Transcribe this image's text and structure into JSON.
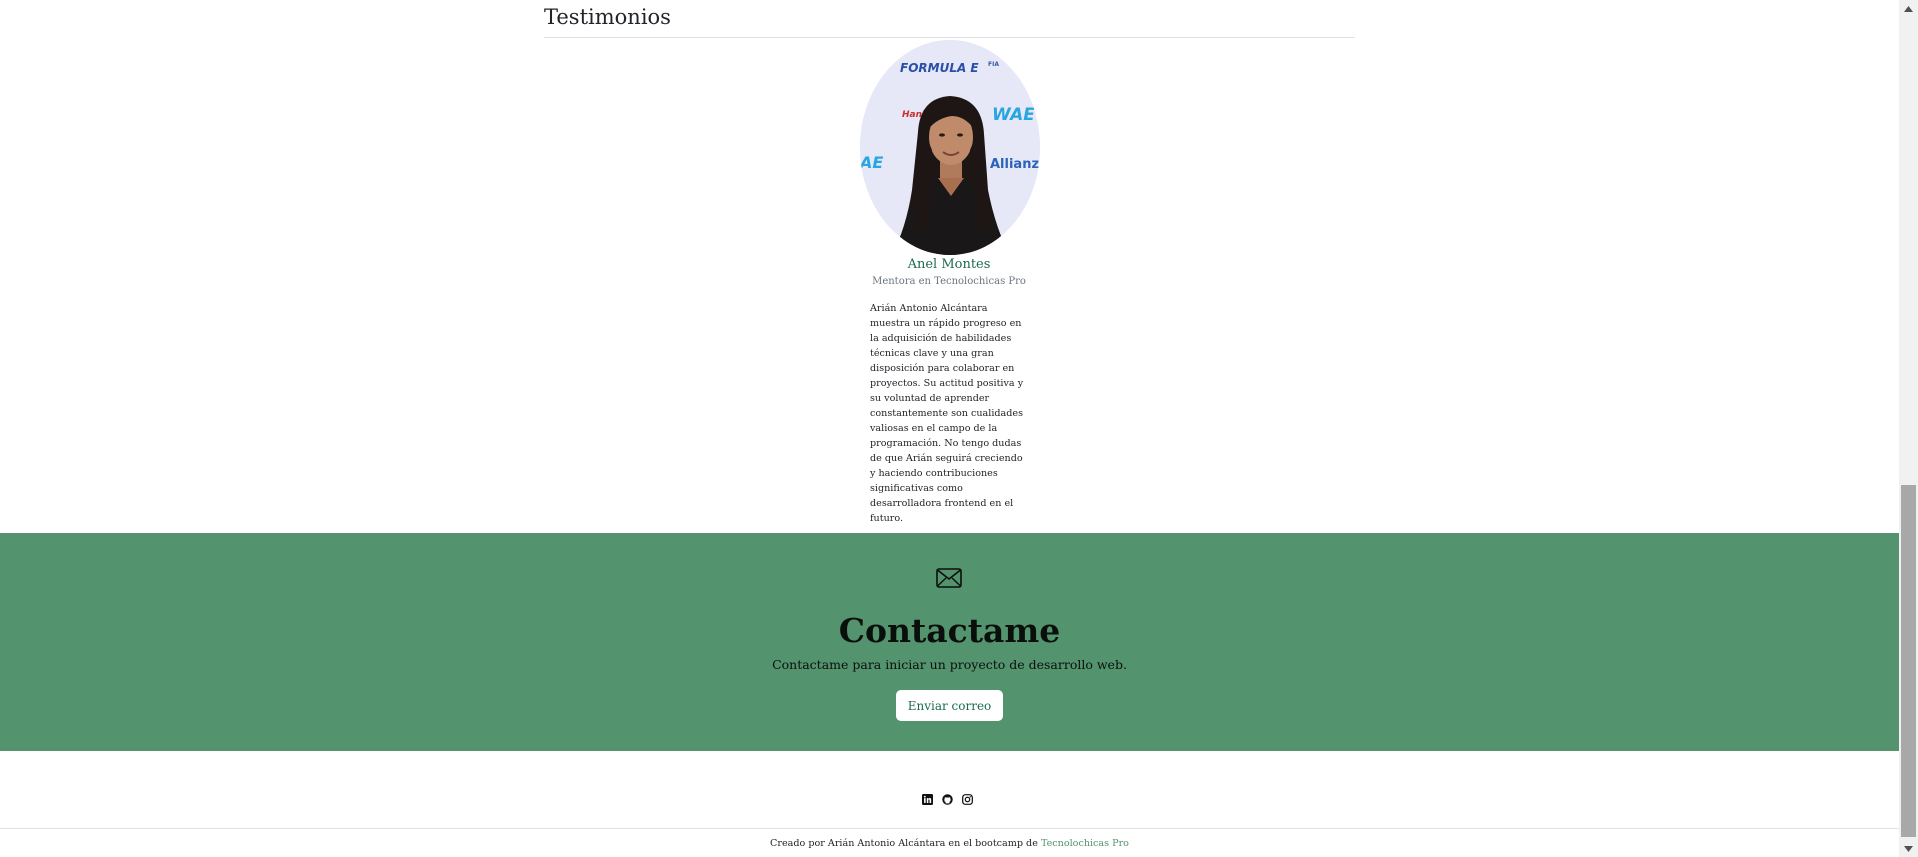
{
  "testimonials": {
    "heading": "Testimonios",
    "items": [
      {
        "name": "Anel Montes",
        "role": "Mentora en Tecnolochicas Pro",
        "text": "Arián Antonio Alcántara muestra un rápido progreso en la adquisición de habilidades técnicas clave y una gran disposición para colaborar en proyectos. Su actitud positiva y su voluntad de aprender constantemente son cualidades valiosas en el campo de la programación. No tengo dudas de que Arián seguirá creciendo y haciendo contribuciones significativas como desarrolladora frontend en el futuro.",
        "photo_backdrop": [
          "FORMULA E",
          "FIA",
          "Hankook",
          "WAE",
          "Allianz",
          "AE"
        ]
      }
    ]
  },
  "contact": {
    "icon": "envelope-icon",
    "title": "Contactame",
    "subtitle": "Contactame para iniciar un proyecto de desarrollo web.",
    "button_label": "Enviar correo",
    "background_color": "#53936e"
  },
  "footer": {
    "social_icons": [
      "linkedin-icon",
      "github-icon",
      "instagram-icon"
    ],
    "credit_prefix": "Creado por Arián Antonio Alcántara en el bootcamp de ",
    "credit_link": "Tecnolochicas Pro",
    "link_color": "#53936e"
  },
  "colors": {
    "accent_green": "#53936e",
    "name_green": "#1d6b4d"
  }
}
